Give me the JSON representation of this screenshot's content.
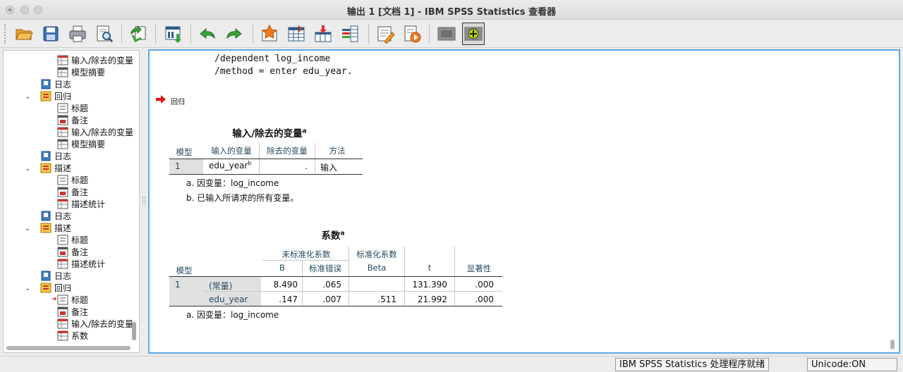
{
  "window": {
    "title": "输出 1 [文档 1] - IBM SPSS Statistics 查看器"
  },
  "toolbar": {
    "buttons": [
      "open-icon",
      "save-icon",
      "print-icon",
      "print-preview-icon",
      "export-icon",
      "goto-data-icon",
      "undo-icon",
      "redo-icon",
      "goto-output-icon",
      "goto-case-icon",
      "insert-variable-icon",
      "variables-icon",
      "designate-window-icon",
      "script-icon",
      "hide-icon",
      "show-icon"
    ]
  },
  "navigator": {
    "items": [
      {
        "label": "输入/除去的变量"
      },
      {
        "label": "模型摘要"
      },
      {
        "label": "日志"
      },
      {
        "label": "回归"
      },
      {
        "label": "标题"
      },
      {
        "label": "备注"
      },
      {
        "label": "输入/除去的变量"
      },
      {
        "label": "模型摘要"
      },
      {
        "label": "日志"
      },
      {
        "label": "描述"
      },
      {
        "label": "标题"
      },
      {
        "label": "备注"
      },
      {
        "label": "描述统计"
      },
      {
        "label": "日志"
      },
      {
        "label": "描述"
      },
      {
        "label": "标题"
      },
      {
        "label": "备注"
      },
      {
        "label": "描述统计"
      },
      {
        "label": "日志"
      },
      {
        "label": "回归"
      },
      {
        "label": "标题"
      },
      {
        "label": "备注"
      },
      {
        "label": "输入/除去的变量"
      },
      {
        "label": "系数"
      }
    ]
  },
  "output": {
    "syntax": [
      "/dependent log_income",
      "/method = enter edu_year."
    ],
    "procedure_title": "回归",
    "table1": {
      "title": "输入/除去的变量",
      "title_sup": "a",
      "headers": [
        "模型",
        "输入的变量",
        "除去的变量",
        "方法"
      ],
      "row": {
        "model": "1",
        "entered": "edu_year",
        "entered_sup": "b",
        "removed": ".",
        "method": "输入"
      },
      "footnotes": [
        "a. 因变量：log_income",
        "b. 已输入所请求的所有变量。"
      ]
    },
    "table2": {
      "title": "系数",
      "title_sup": "a",
      "group_headers": [
        "未标准化系数",
        "标准化系数"
      ],
      "headers": [
        "模型",
        "B",
        "标准错误",
        "Beta",
        "t",
        "显著性"
      ],
      "rows": [
        {
          "model": "1",
          "term": "(常量)",
          "B": "8.490",
          "se": ".065",
          "beta": "",
          "t": "131.390",
          "sig": ".000"
        },
        {
          "model": "",
          "term": "edu_year",
          "B": ".147",
          "se": ".007",
          "beta": ".511",
          "t": "21.992",
          "sig": ".000"
        }
      ],
      "footnotes": [
        "a. 因变量：log_income"
      ]
    }
  },
  "statusbar": {
    "processor": "IBM SPSS Statistics 处理程序就绪",
    "unicode": "Unicode:ON"
  }
}
